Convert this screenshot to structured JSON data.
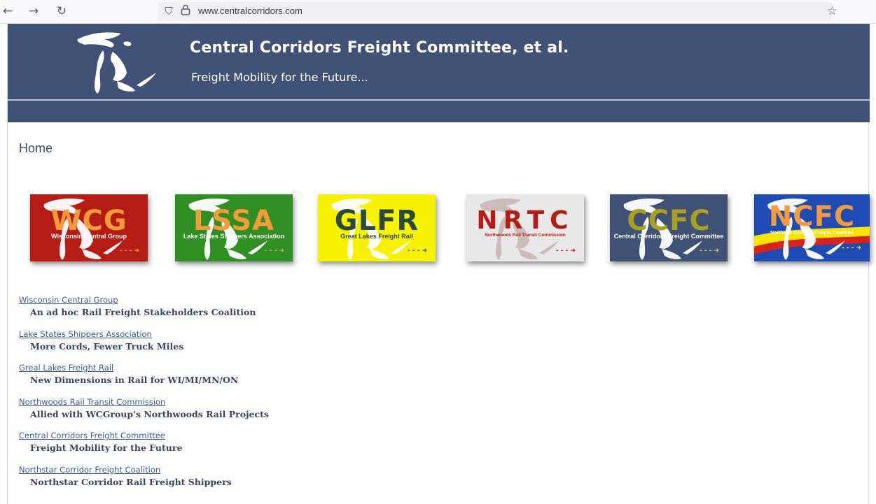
{
  "browser": {
    "back_icon": "back-arrow-icon",
    "forward_icon": "forward-arrow-icon",
    "reload_icon": "reload-icon",
    "url": "www.centralcorridors.com"
  },
  "header": {
    "title": "Central Corridors Freight Committee, et al.",
    "tagline": "Freight Mobility for the Future...",
    "colors": {
      "background": "#405276",
      "text": "#ffffff"
    }
  },
  "page": {
    "heading": "Home"
  },
  "tiles": [
    {
      "abbr": "WCG",
      "name": "Wisconsin Central Group",
      "bg": "#b51c14",
      "abbr_color": "#f39a3b",
      "name_color": "#ffffff",
      "arrow_color": "#f3a04a",
      "map_color": "#ffffff"
    },
    {
      "abbr": "LSSA",
      "name": "Lake States Shippers Association",
      "bg": "#2f8f23",
      "abbr_color": "#f39a3b",
      "name_color": "#ffffff",
      "arrow_color": "#f3a04a",
      "map_color": "#ffffff"
    },
    {
      "abbr": "GLFR",
      "name": "Great Lakes Freight Rail",
      "bg": "#f7f200",
      "abbr_color": "#2c4a3a",
      "name_color": "#2c4a3a",
      "arrow_color": "#2c4a3a",
      "map_color": "#ffffff"
    },
    {
      "abbr": "NRTC",
      "name": "Northwoods Rail Transit Commission",
      "bg": "#e8e8e8",
      "abbr_color": "#b51c14",
      "name_color": "#b51c14",
      "arrow_color": "#b51c14",
      "map_color": "#c9b7b7"
    },
    {
      "abbr": "CCFC",
      "name": "Central Corridors Freight Committee",
      "bg": "#3f5175",
      "abbr_color": "#a8a020",
      "name_color": "#ffffff",
      "arrow_color": "#e0d15a",
      "map_color": "#ffffff"
    },
    {
      "abbr": "NCFC",
      "name": "Northstar Corridor Freight Coalition",
      "bg": "#1f4bb5",
      "abbr_color": "#f39a3b",
      "name_color": "#ffffff",
      "arrow_color": "#f7e400",
      "map_color": "#ffffff"
    }
  ],
  "organizations": [
    {
      "link": "Wisconsin Central Group",
      "description": "An ad hoc Rail Freight Stakeholders Coalition"
    },
    {
      "link": "Lake States Shippers Association",
      "description": "More Cords, Fewer Truck Miles"
    },
    {
      "link": "Greal Lakes Freight Rail",
      "description": "New Dimensions in Rail for WI/MI/MN/ON"
    },
    {
      "link": "Northwoods Rail Transit Commission",
      "description": "Allied with WCGroup's Northwoods Rail Projects"
    },
    {
      "link": "Central Corridors Freight Committee",
      "description": "Freight Mobility for the Future"
    },
    {
      "link": "Northstar Corridor Freight Coalition",
      "description": "Northstar Corridor Rail Freight Shippers"
    }
  ]
}
